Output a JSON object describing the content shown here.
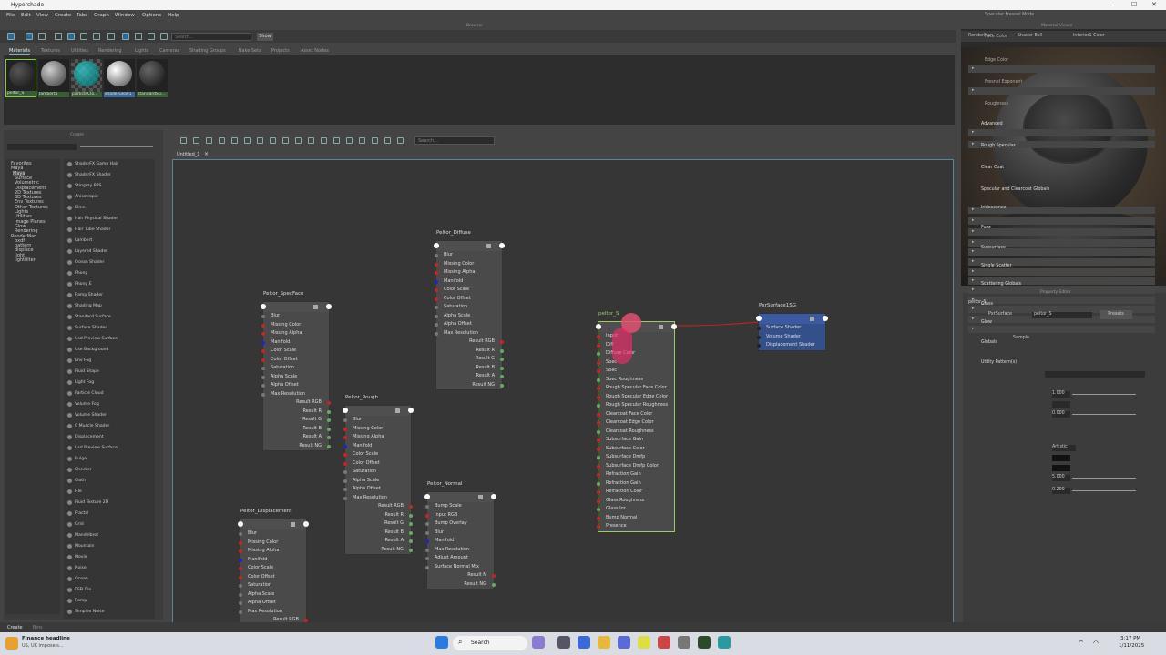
{
  "window": {
    "title": "Hypershade"
  },
  "menu": [
    "File",
    "Edit",
    "View",
    "Create",
    "Tabs",
    "Graph",
    "Window",
    "Options",
    "Help"
  ],
  "panel_titles": {
    "browser": "Browser",
    "viewer": "Material Viewer",
    "create": "Create",
    "property": "Property Editor"
  },
  "toolbar": {
    "search_placeholder": "Search...",
    "show_label": "Show"
  },
  "browser_tabs": [
    "Materials",
    "Textures",
    "Utilities",
    "Rendering",
    "Lights",
    "Cameras",
    "Shading Groups",
    "Bake Sets",
    "Projects",
    "Asset Nodes"
  ],
  "swatches": [
    {
      "label": "peltor_S",
      "color": "#3a3a3a"
    },
    {
      "label": "lambert1",
      "color": "#777"
    },
    {
      "label": "particleClo...",
      "color": "#2aa8a0"
    },
    {
      "label": "shaderGlow1",
      "color": "#bbb"
    },
    {
      "label": "standardSu...",
      "color": "#555"
    }
  ],
  "create_tree": [
    "Favorites",
    "Maya",
    "Maya",
    "Surface",
    "Volumetric",
    "Displacement",
    "2D Textures",
    "3D Textures",
    "Env Textures",
    "Other Textures",
    "Lights",
    "Utilities",
    "Image Planes",
    "Glow",
    "Rendering",
    "RenderMan",
    "bxdf",
    "pattern",
    "displace",
    "light",
    "lightfilter"
  ],
  "create_list": [
    "ShaderFX Game Hair",
    "ShaderFX Shader",
    "Stingray PBS",
    "Anisotropic",
    "Blinn",
    "Hair Physical Shader",
    "Hair Tube Shader",
    "Lambert",
    "Layered Shader",
    "Ocean Shader",
    "Phong",
    "Phong E",
    "Ramp Shader",
    "Shading Map",
    "Standard Surface",
    "Surface Shader",
    "Usd Preview Surface",
    "Use Background",
    "Env Fog",
    "Fluid Shape",
    "Light Fog",
    "Particle Cloud",
    "Volume Fog",
    "Volume Shader",
    "C Muscle Shader",
    "Displacement",
    "Usd Preview Surface",
    "Bulge",
    "Checker",
    "Cloth",
    "File",
    "Fluid Texture 2D",
    "Fractal",
    "Grid",
    "Mandelbrot",
    "Mountain",
    "Movie",
    "Noise",
    "Ocean",
    "PSD File",
    "Ramp",
    "Simplex Noise"
  ],
  "graph": {
    "tab_label": "Untitled_1",
    "search_placeholder": "Search..."
  },
  "nodes": {
    "diffuse": {
      "title": "Peltor_Diffuse",
      "rows": [
        "Blur",
        "Missing Color",
        "Missing Alpha",
        "Manifold",
        "Color Scale",
        "Color Offset",
        "Saturation",
        "Alpha Scale",
        "Alpha Offset",
        "Max Resolution",
        "Result RGB",
        "Result R",
        "Result G",
        "Result B",
        "Result A",
        "Result NG"
      ]
    },
    "specface": {
      "title": "Peltor_SpecFace",
      "rows": [
        "Blur",
        "Missing Color",
        "Missing Alpha",
        "Manifold",
        "Color Scale",
        "Color Offset",
        "Saturation",
        "Alpha Scale",
        "Alpha Offset",
        "Max Resolution",
        "Result RGB",
        "Result R",
        "Result G",
        "Result B",
        "Result A",
        "Result NG"
      ]
    },
    "rough": {
      "title": "Peltor_Rough",
      "rows": [
        "Blur",
        "Missing Color",
        "Missing Alpha",
        "Manifold",
        "Color Scale",
        "Color Offset",
        "Saturation",
        "Alpha Scale",
        "Alpha Offset",
        "Max Resolution",
        "Result RGB",
        "Result R",
        "Result G",
        "Result B",
        "Result A",
        "Result NG"
      ]
    },
    "displacement": {
      "title": "Peltor_Displacement",
      "rows": [
        "Blur",
        "Missing Color",
        "Missing Alpha",
        "Manifold",
        "Color Scale",
        "Color Offset",
        "Saturation",
        "Alpha Scale",
        "Alpha Offset",
        "Max Resolution",
        "Result RGB"
      ]
    },
    "normal": {
      "title": "Peltor_Normal",
      "rows": [
        "Bump Scale",
        "Input RGB",
        "Bump Overlay",
        "Blur",
        "Manifold",
        "Max Resolution",
        "Adjust Amount",
        "Surface Normal Mix",
        "Result N",
        "Result NG"
      ]
    },
    "peltor_s": {
      "title": "peltor_S",
      "rows": [
        "Input",
        "Diff",
        "Diffuse Color",
        "Spec",
        "Spec",
        "Spec Roughness",
        "Rough Specular Face Color",
        "Rough Specular Edge Color",
        "Rough Specular Roughness",
        "Clearcoat Face Color",
        "Clearcoat Edge Color",
        "Clearcoat Roughness",
        "Subsurface Gain",
        "Subsurface Color",
        "Subsurface Dmfp",
        "Subsurface Dmfp Color",
        "Refraction Gain",
        "Refraction Gain",
        "Refraction Color",
        "Glass Roughness",
        "Glass Ior",
        "Bump Normal",
        "Presence"
      ]
    },
    "sg": {
      "title": "PxrSurface1SG",
      "rows": [
        "Surface Shader",
        "Volume Shader",
        "Displacement Shader"
      ]
    }
  },
  "viewer_bar": [
    "RenderMan",
    "Shader Ball",
    "Interior1 Color"
  ],
  "property": {
    "node": "peltor_S",
    "type_label": "PxrSurface",
    "type_value": "peltor_S",
    "presets": "Presets",
    "sample": "Sample",
    "sections": [
      "Parameters",
      "Input Material",
      "Diffuse",
      "Gain",
      "Color",
      "Roughness",
      "Advanced",
      "Primary Specular",
      "Specular Fresnel Mode",
      "Face Color",
      "Edge Color",
      "Fresnel Exponent",
      "Roughness",
      "Advanced",
      "Rough Specular",
      "Clear Coat",
      "Specular and Clearcoat Globals",
      "Iridescence",
      "Fuzz",
      "Subsurface",
      "Single Scatter",
      "Scattering Globals",
      "Glass",
      "Glow",
      "Globals",
      "Utility Pattern(s)"
    ],
    "values": {
      "gain": "1.000",
      "roughness": "0.000",
      "fresnel_mode": "Artistic",
      "fresnel_exp": "5.000",
      "spec_rough": "0.200"
    }
  },
  "bottom_tabs": [
    "Create",
    "Bins"
  ],
  "taskbar": {
    "news_title": "Finance headline",
    "news_sub": "US, UK impose s...",
    "search": "Search",
    "time": "3:17 PM",
    "date": "1/11/2025"
  }
}
